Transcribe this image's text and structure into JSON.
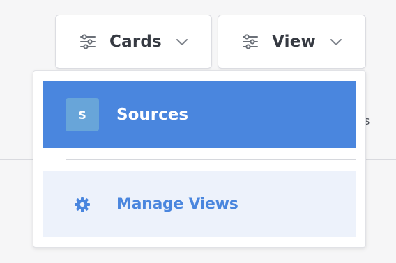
{
  "toolbar": {
    "cards_label": "Cards",
    "cards_icon": "sliders-icon",
    "view_label": "View",
    "view_icon": "sliders-icon",
    "chevron_icon": "chevron-down-icon"
  },
  "dropdown": {
    "items": [
      {
        "label": "Sources",
        "avatar_letter": "S",
        "selected": true
      },
      {
        "label": "Manage Views",
        "icon": "gear-icon",
        "selected": false
      }
    ]
  },
  "colors": {
    "accent": "#4a86de",
    "avatar_bg": "#68a5d9",
    "manage_bg": "#edf2fb",
    "text_dark": "#363a42",
    "icon_gray": "#6b7078"
  }
}
